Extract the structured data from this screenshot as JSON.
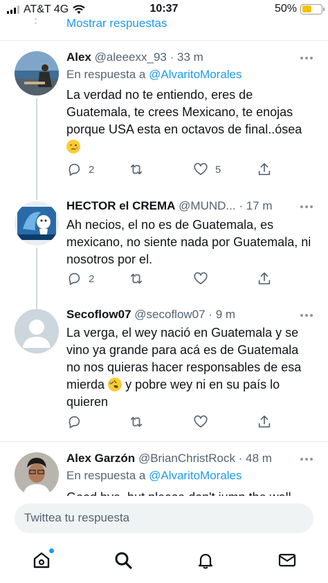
{
  "status_bar": {
    "carrier": "AT&T 4G",
    "time": "10:37",
    "battery_percent": "50%",
    "battery_level": 0.5
  },
  "thread": {
    "show_replies": "Mostrar respuestas"
  },
  "tweets": [
    {
      "name": "Alex",
      "handle": "@aleeexx_93",
      "time": "· 33 m",
      "reply_prefix": "En respuesta a",
      "reply_to": "@AlvaritoMorales",
      "text": "La verdad no te entiendo, eres de Guatemala, te crees Mexicano, te enojas porque USA esta en octavos de final..ósea",
      "replies": "2",
      "retweets": "",
      "likes": "5"
    },
    {
      "name": "HECTOR el CREMA",
      "handle": "@MUND...",
      "time": "· 17 m",
      "text": "Ah necios, el no es de Guatemala, es mexicano, no siente nada por Guatemala, ni nosotros por el.",
      "replies": "2",
      "retweets": "",
      "likes": ""
    },
    {
      "name": "Secoflow07",
      "handle": "@secoflow07",
      "time": "· 9 m",
      "text_before_emoji": "La verga, el wey nació en Guatemala y se vino ya grande para acá es de Guatemala no nos quieras hacer responsables de esa mierda",
      "text_after_emoji": "y pobre wey ni en su país lo quieren",
      "replies": "",
      "retweets": "",
      "likes": ""
    },
    {
      "name": "Alex Garzón",
      "handle": "@BrianChristRock",
      "time": "· 48 m",
      "reply_prefix": "En respuesta a",
      "reply_to": "@AlvaritoMorales",
      "text": "Good bye, but please don't jump the wall"
    }
  ],
  "compose": {
    "placeholder": "Twittea tu respuesta"
  },
  "tabbar": {
    "items": [
      "home-icon",
      "search-icon",
      "notifications-icon",
      "messages-icon"
    ]
  },
  "colors": {
    "accent": "#1d9bf0",
    "text": "#0f1419",
    "muted": "#536471"
  }
}
